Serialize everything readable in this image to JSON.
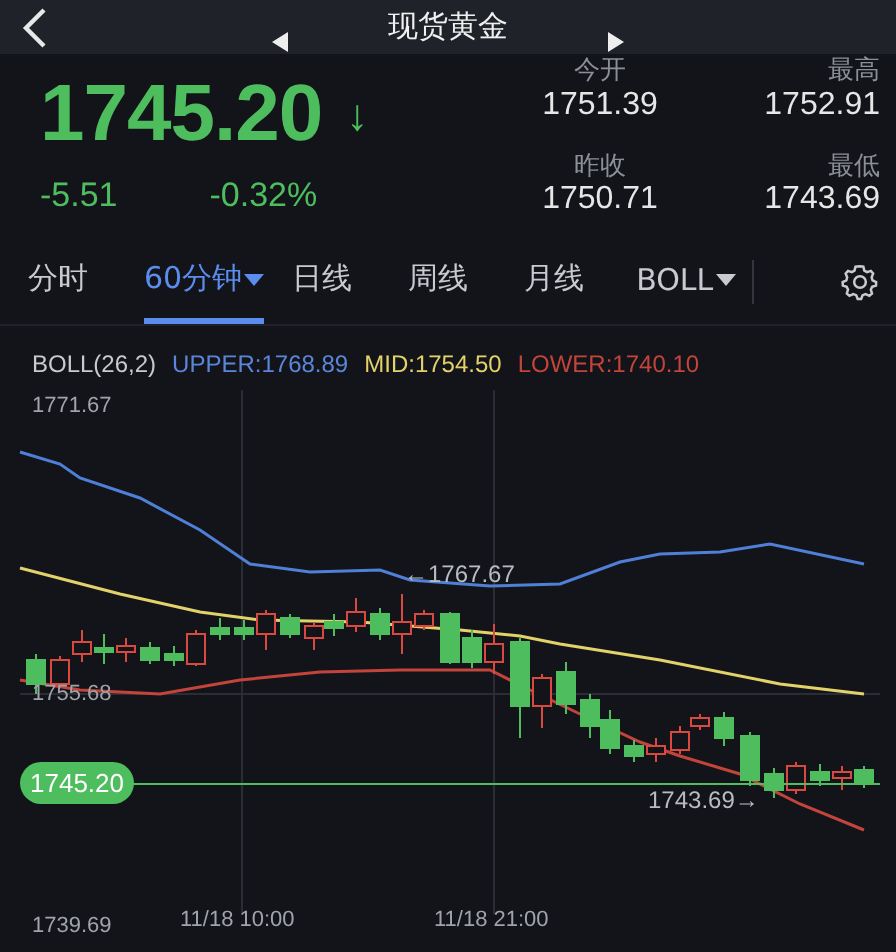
{
  "header": {
    "title": "现货黄金"
  },
  "quote": {
    "price": "1745.20",
    "arrow": "↓",
    "change": "-5.51",
    "percent": "-0.32%",
    "stats": [
      {
        "label": "今开",
        "value": "1751.39"
      },
      {
        "label": "最高",
        "value": "1752.91"
      },
      {
        "label": "昨收",
        "value": "1750.71"
      },
      {
        "label": "最低",
        "value": "1743.69"
      }
    ]
  },
  "tabs": [
    {
      "label": "分时",
      "selected": false,
      "dropdown": false
    },
    {
      "label": "60分钟",
      "selected": true,
      "dropdown": true
    },
    {
      "label": "日线",
      "selected": false,
      "dropdown": false
    },
    {
      "label": "周线",
      "selected": false,
      "dropdown": false
    },
    {
      "label": "月线",
      "selected": false,
      "dropdown": false
    },
    {
      "label": "BOLL",
      "selected": false,
      "dropdown": true
    }
  ],
  "legend": [
    {
      "text": "BOLL(26,2)",
      "color": "#c8cad0"
    },
    {
      "text": "UPPER:1768.89",
      "color": "#5b86d8"
    },
    {
      "text": "MID:1754.50",
      "color": "#e3d26a"
    },
    {
      "text": "LOWER:1740.10",
      "color": "#c2443a"
    }
  ],
  "chart": {
    "y_labels": [
      "1771.67",
      "1755.68",
      "1739.69"
    ],
    "x_labels": [
      "11/18 10:00",
      "11/18 21:00"
    ],
    "current": "1745.20",
    "high_marker": "←1767.67",
    "low_marker": "1743.69→"
  }
}
